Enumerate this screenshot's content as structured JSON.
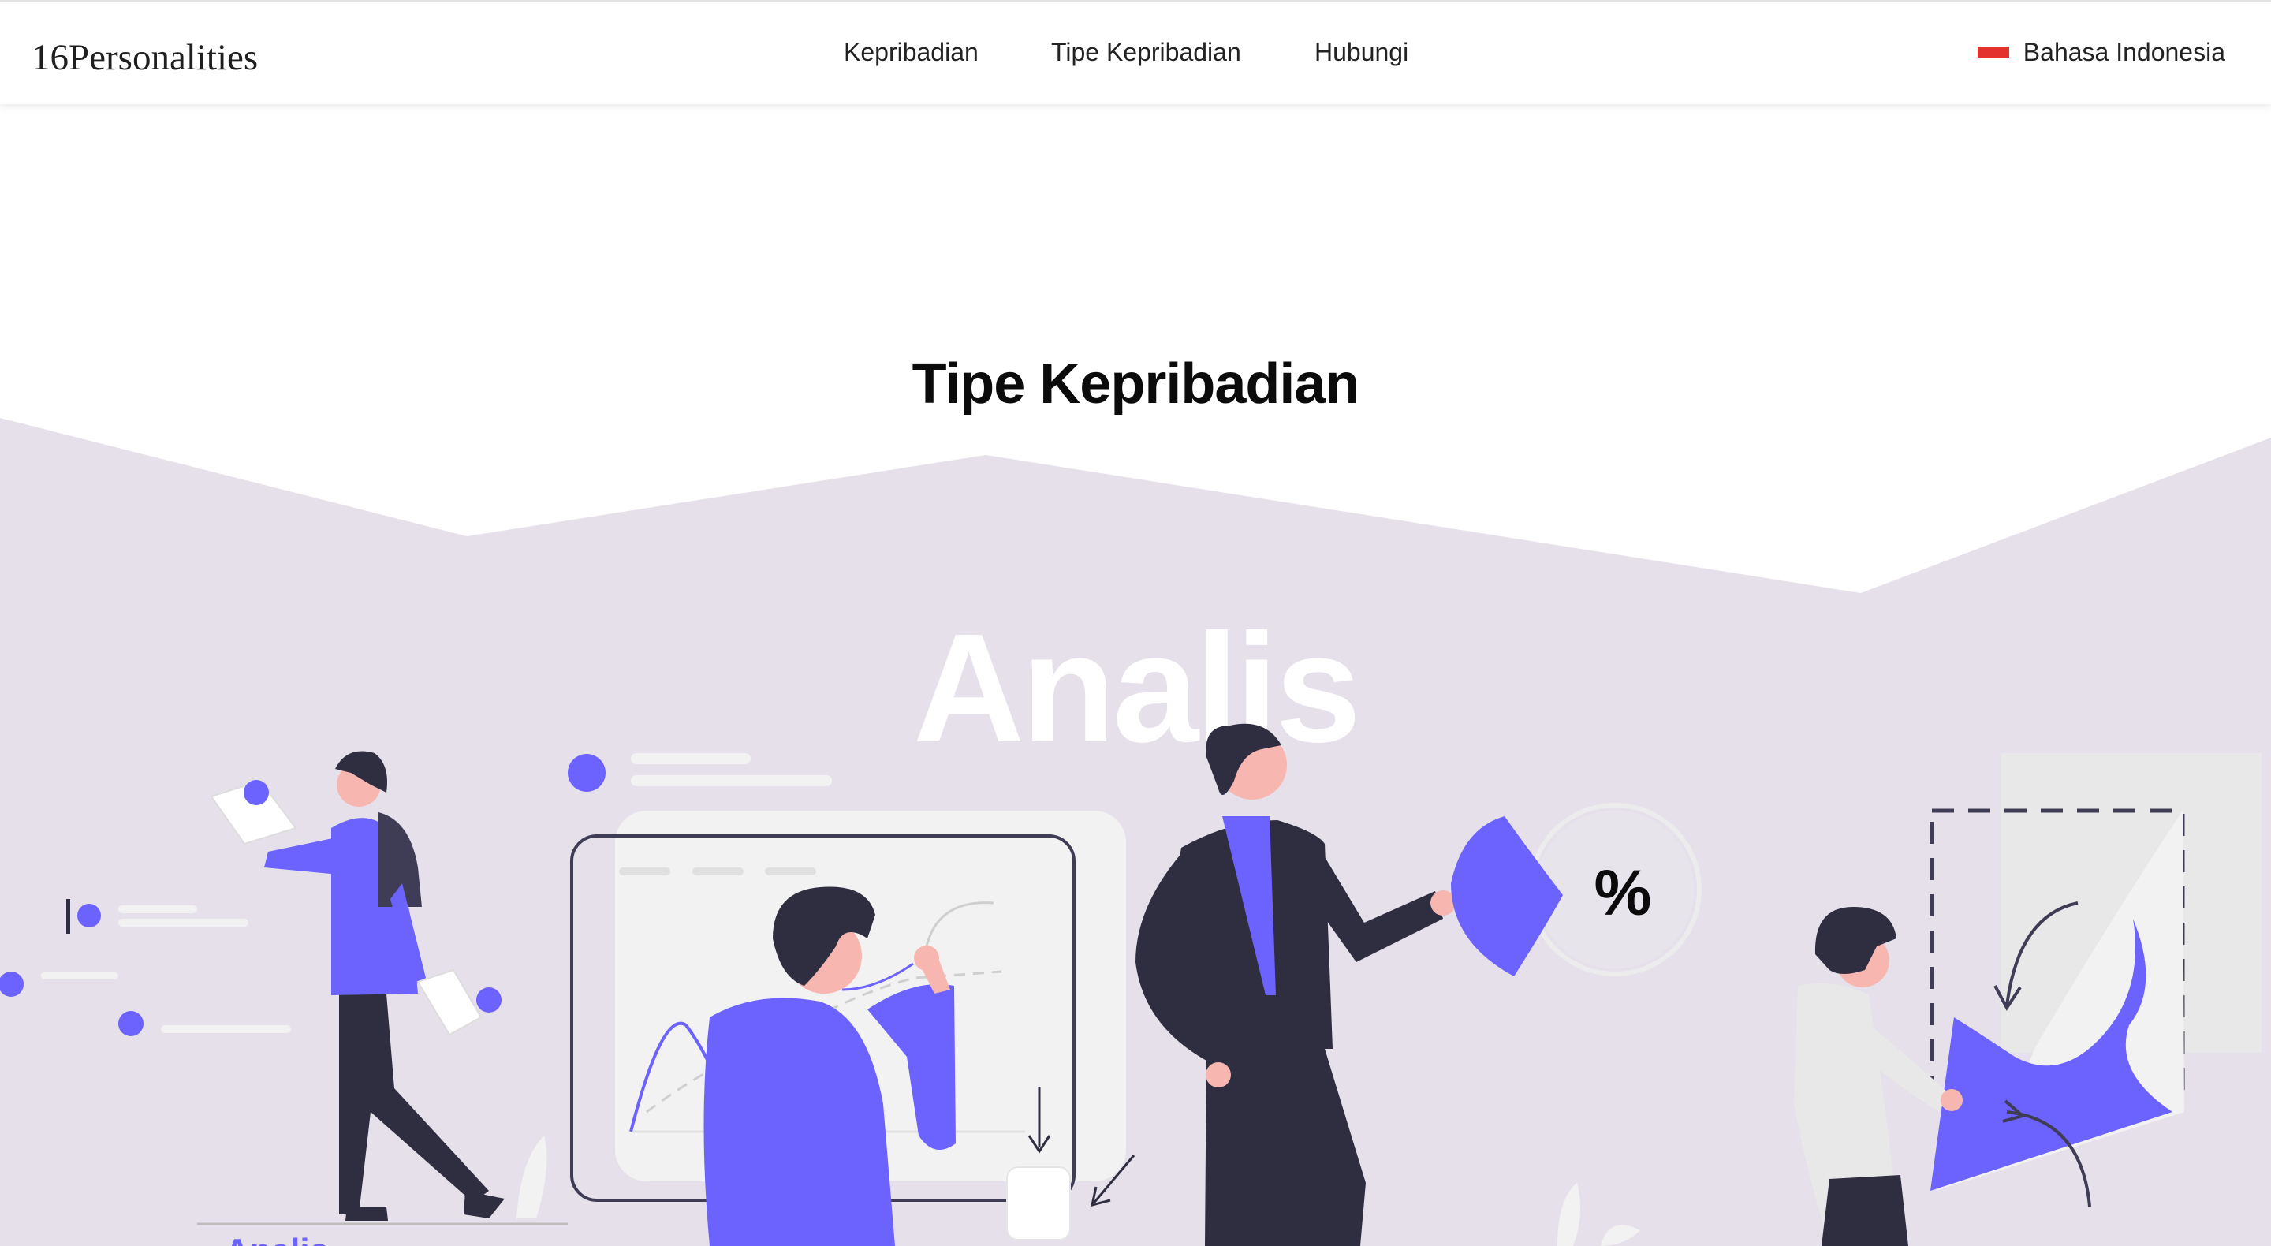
{
  "header": {
    "logo": "16Personalities",
    "nav": [
      "Kepribadian",
      "Tipe Kepribadian",
      "Hubungi"
    ],
    "language": "Bahasa Indonesia",
    "flag_icon": "indonesia-flag-icon"
  },
  "main": {
    "title": "Tipe Kepribadian",
    "hero_word": "Analis",
    "percent_label": "%",
    "partial_text": "Analis"
  },
  "colors": {
    "background_band": "#e6e0ea",
    "accent": "#6c63ff",
    "dark": "#2f2e41",
    "skin": "#f7b6b0"
  }
}
